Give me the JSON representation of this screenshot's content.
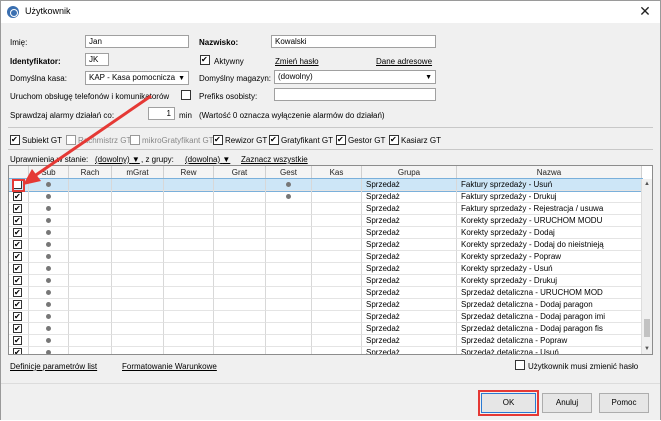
{
  "window": {
    "title": "Użytkownik",
    "close_glyph": "✕"
  },
  "form": {
    "imie_label": "Imię:",
    "imie_value": "Jan",
    "nazwisko_label": "Nazwisko:",
    "nazwisko_value": "Kowalski",
    "identyfikator_label": "Identyfikator:",
    "identyfikator_value": "JK",
    "aktywny_label": "Aktywny",
    "zmien_haslo": "Zmień hasło",
    "dane_adresowe": "Dane adresowe",
    "domyslna_kasa_label": "Domyślna kasa:",
    "domyslna_kasa_value": "KAP - Kasa pomocnicza",
    "domyslny_magazyn_label": "Domyślny magazyn:",
    "domyslny_magazyn_value": "(dowolny)",
    "uruchom_label": "Uruchom obsługę telefonów i komunikatorów",
    "prefiks_label": "Prefiks osobisty:",
    "prefiks_value": "",
    "alarmy_label": "Sprawdzaj alarmy działań co:",
    "alarmy_value": "1",
    "alarmy_unit": "min",
    "alarmy_note": "(Wartość 0 oznacza wyłączenie alarmów do działań)"
  },
  "modules": [
    {
      "label": "Subiekt GT",
      "checked": true,
      "disabled": false
    },
    {
      "label": "Rachmistrz GT",
      "checked": false,
      "disabled": true
    },
    {
      "label": "mikroGratyfikant GT",
      "checked": false,
      "disabled": true
    },
    {
      "label": "Rewizor GT",
      "checked": true,
      "disabled": false
    },
    {
      "label": "Gratyfikant GT",
      "checked": true,
      "disabled": false
    },
    {
      "label": "Gestor GT",
      "checked": true,
      "disabled": false
    },
    {
      "label": "Kasiarz GT",
      "checked": true,
      "disabled": false
    }
  ],
  "filter": {
    "uprawnienia_label": "Uprawnienia w stanie:",
    "stan_value": "(dowolny)",
    "z_grupy_label": ", z grupy:",
    "grupa_value": "(dowolna)",
    "zaznacz_wszystkie": "Zaznacz wszystkie"
  },
  "grid": {
    "columns": [
      "",
      "Sub",
      "Rach",
      "mGrat",
      "Rew",
      "Grat",
      "Gest",
      "Kas",
      "Grupa",
      "Nazwa"
    ],
    "rows": [
      {
        "checked": false,
        "sub": true,
        "gest": true,
        "grupa": "Sprzedaż",
        "nazwa": "Faktury sprzedaży - Usuń",
        "selected": true
      },
      {
        "checked": true,
        "sub": true,
        "gest": true,
        "grupa": "Sprzedaż",
        "nazwa": "Faktury sprzedaży - Drukuj"
      },
      {
        "checked": true,
        "sub": true,
        "gest": false,
        "grupa": "Sprzedaż",
        "nazwa": "Faktury sprzedaży - Rejestracja / usuwa"
      },
      {
        "checked": true,
        "sub": true,
        "gest": false,
        "grupa": "Sprzedaż",
        "nazwa": "Korekty sprzedaży - URUCHOM MODU"
      },
      {
        "checked": true,
        "sub": true,
        "gest": false,
        "grupa": "Sprzedaż",
        "nazwa": "Korekty sprzedaży - Dodaj"
      },
      {
        "checked": true,
        "sub": true,
        "gest": false,
        "grupa": "Sprzedaż",
        "nazwa": "Korekty sprzedaży - Dodaj do nieistnieją"
      },
      {
        "checked": true,
        "sub": true,
        "gest": false,
        "grupa": "Sprzedaż",
        "nazwa": "Korekty sprzedaży - Popraw"
      },
      {
        "checked": true,
        "sub": true,
        "gest": false,
        "grupa": "Sprzedaż",
        "nazwa": "Korekty sprzedaży - Usuń"
      },
      {
        "checked": true,
        "sub": true,
        "gest": false,
        "grupa": "Sprzedaż",
        "nazwa": "Korekty sprzedaży - Drukuj"
      },
      {
        "checked": true,
        "sub": true,
        "gest": false,
        "grupa": "Sprzedaż",
        "nazwa": "Sprzedaż detaliczna - URUCHOM MOD"
      },
      {
        "checked": true,
        "sub": true,
        "gest": false,
        "grupa": "Sprzedaż",
        "nazwa": "Sprzedaż detaliczna - Dodaj paragon"
      },
      {
        "checked": true,
        "sub": true,
        "gest": false,
        "grupa": "Sprzedaż",
        "nazwa": "Sprzedaż detaliczna - Dodaj paragon imi"
      },
      {
        "checked": true,
        "sub": true,
        "gest": false,
        "grupa": "Sprzedaż",
        "nazwa": "Sprzedaż detaliczna - Dodaj paragon fis"
      },
      {
        "checked": true,
        "sub": true,
        "gest": false,
        "grupa": "Sprzedaż",
        "nazwa": "Sprzedaż detaliczna - Popraw"
      },
      {
        "checked": true,
        "sub": true,
        "gest": false,
        "grupa": "Sprzedaż",
        "nazwa": "Sprzedaż detaliczna - Usuń"
      }
    ]
  },
  "footer_links": {
    "definicje": "Definicje parametrów list",
    "formatowanie": "Formatowanie Warunkowe",
    "musi_zmienic": "Użytkownik musi zmienić hasło"
  },
  "buttons": {
    "ok": "OK",
    "anuluj": "Anuluj",
    "pomoc": "Pomoc"
  },
  "colors": {
    "highlight": "#e53935",
    "selection": "#cde6f7"
  },
  "icons": {
    "app": "app-logo-icon",
    "close": "close-icon",
    "dropdown": "chevron-down-icon"
  }
}
